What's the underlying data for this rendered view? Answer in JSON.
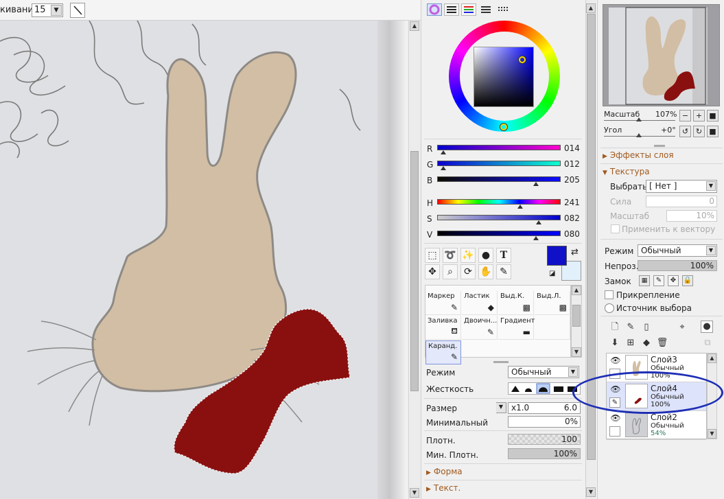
{
  "toolbar": {
    "smoothing_label": "кивание",
    "smoothing_value": "15"
  },
  "color": {
    "sliders": [
      {
        "ch": "R",
        "value": "014",
        "pos": 0.05,
        "grad": "linear-gradient(90deg,#0000cd,#ff00cd)"
      },
      {
        "ch": "G",
        "value": "012",
        "pos": 0.05,
        "grad": "linear-gradient(90deg,#0e00cd,#0effcd)"
      },
      {
        "ch": "B",
        "value": "205",
        "pos": 0.8,
        "grad": "linear-gradient(90deg,#0e0c00,#0e0cff)"
      },
      {
        "ch": "H",
        "value": "241",
        "pos": 0.67,
        "grad": "linear-gradient(90deg,#f00,#ff0,#0f0,#0ff,#00f,#f0f,#f00)"
      },
      {
        "ch": "S",
        "value": "082",
        "pos": 0.82,
        "grad": "linear-gradient(90deg,#cdcdcd,#0000cd)"
      },
      {
        "ch": "V",
        "value": "080",
        "pos": 0.8,
        "grad": "linear-gradient(90deg,#000,#0000ff)"
      }
    ],
    "main": "#1010c8",
    "sub": "#e2f0fb"
  },
  "brushes": [
    {
      "label": "Маркер",
      "icon": "✎"
    },
    {
      "label": "Ластик",
      "icon": "◆"
    },
    {
      "label": "Выд.К.",
      "icon": "▩"
    },
    {
      "label": "Выд.Л.",
      "icon": "▩"
    },
    {
      "label": "Заливка",
      "icon": "⛾"
    },
    {
      "label": "Двоичн...",
      "icon": "✎"
    },
    {
      "label": "Градиент",
      "icon": "▬"
    },
    {
      "label": "",
      "icon": ""
    },
    {
      "label": "Каранд.",
      "icon": "✎"
    }
  ],
  "brush_props": {
    "mode_label": "Режим",
    "mode_value": "Обычный",
    "hardness_label": "Жесткость",
    "size_label": "Размер",
    "size_mult": "x1.0",
    "size_value": "6.0",
    "min_label": "Минимальный",
    "min_value": "0%",
    "density_label": "Плотн.",
    "density_value": "100",
    "min_density_label": "Мин. Плотн.",
    "min_density_value": "100%",
    "shape_label": "Форма",
    "text_label": "Текст."
  },
  "navigator": {
    "zoom_label": "Масштаб",
    "zoom_value": "107%",
    "angle_label": "Угол",
    "angle_value": "+0°"
  },
  "layer_panel": {
    "effects_label": "Эффекты слоя",
    "texture_label": "Текстура",
    "choose_label": "Выбрать",
    "choose_value": "[ Нет ]",
    "strength_label": "Сила",
    "strength_value": "0",
    "scale_label": "Масштаб",
    "scale_value": "10%",
    "apply_vector_label": "Применить к вектору",
    "mode_label": "Режим",
    "mode_value": "Обычный",
    "opacity_label": "Непроз.",
    "opacity_value": "100%",
    "lock_label": "Замок",
    "clip_label": "Прикрепление",
    "source_label": "Источник выбора"
  },
  "layers": [
    {
      "name": "Слой3",
      "mode": "Обычный",
      "opacity": "100%"
    },
    {
      "name": "Слой4",
      "mode": "Обычный",
      "opacity": "100%"
    },
    {
      "name": "Слой2",
      "mode": "Обычный",
      "opacity": "54%"
    }
  ]
}
